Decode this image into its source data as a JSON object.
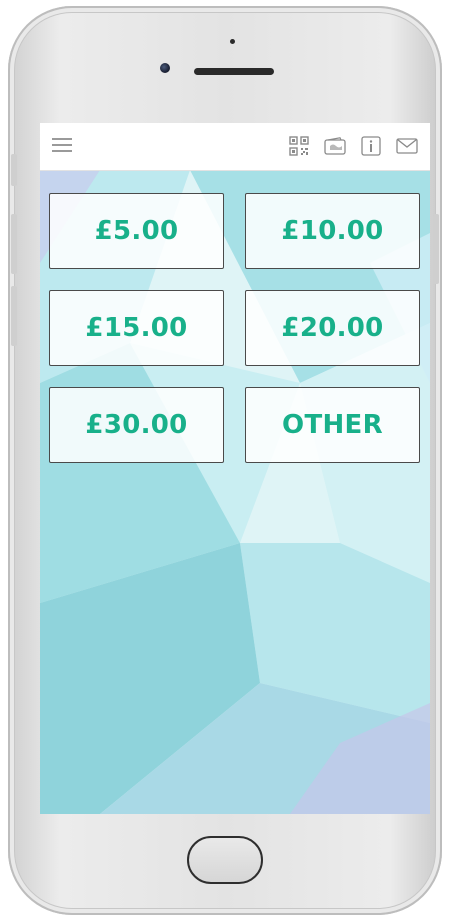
{
  "header": {
    "icons": [
      "menu-icon",
      "qr-code-icon",
      "wallet-icon",
      "info-icon",
      "mail-icon"
    ]
  },
  "amounts": {
    "items": [
      {
        "label": "£5.00"
      },
      {
        "label": "£10.00"
      },
      {
        "label": "£15.00"
      },
      {
        "label": "£20.00"
      },
      {
        "label": "£30.00"
      },
      {
        "label": "OTHER"
      }
    ]
  },
  "colors": {
    "accent": "#18b08a",
    "app_bar": "#ffffff",
    "background_tint": "#7fd6dc"
  }
}
